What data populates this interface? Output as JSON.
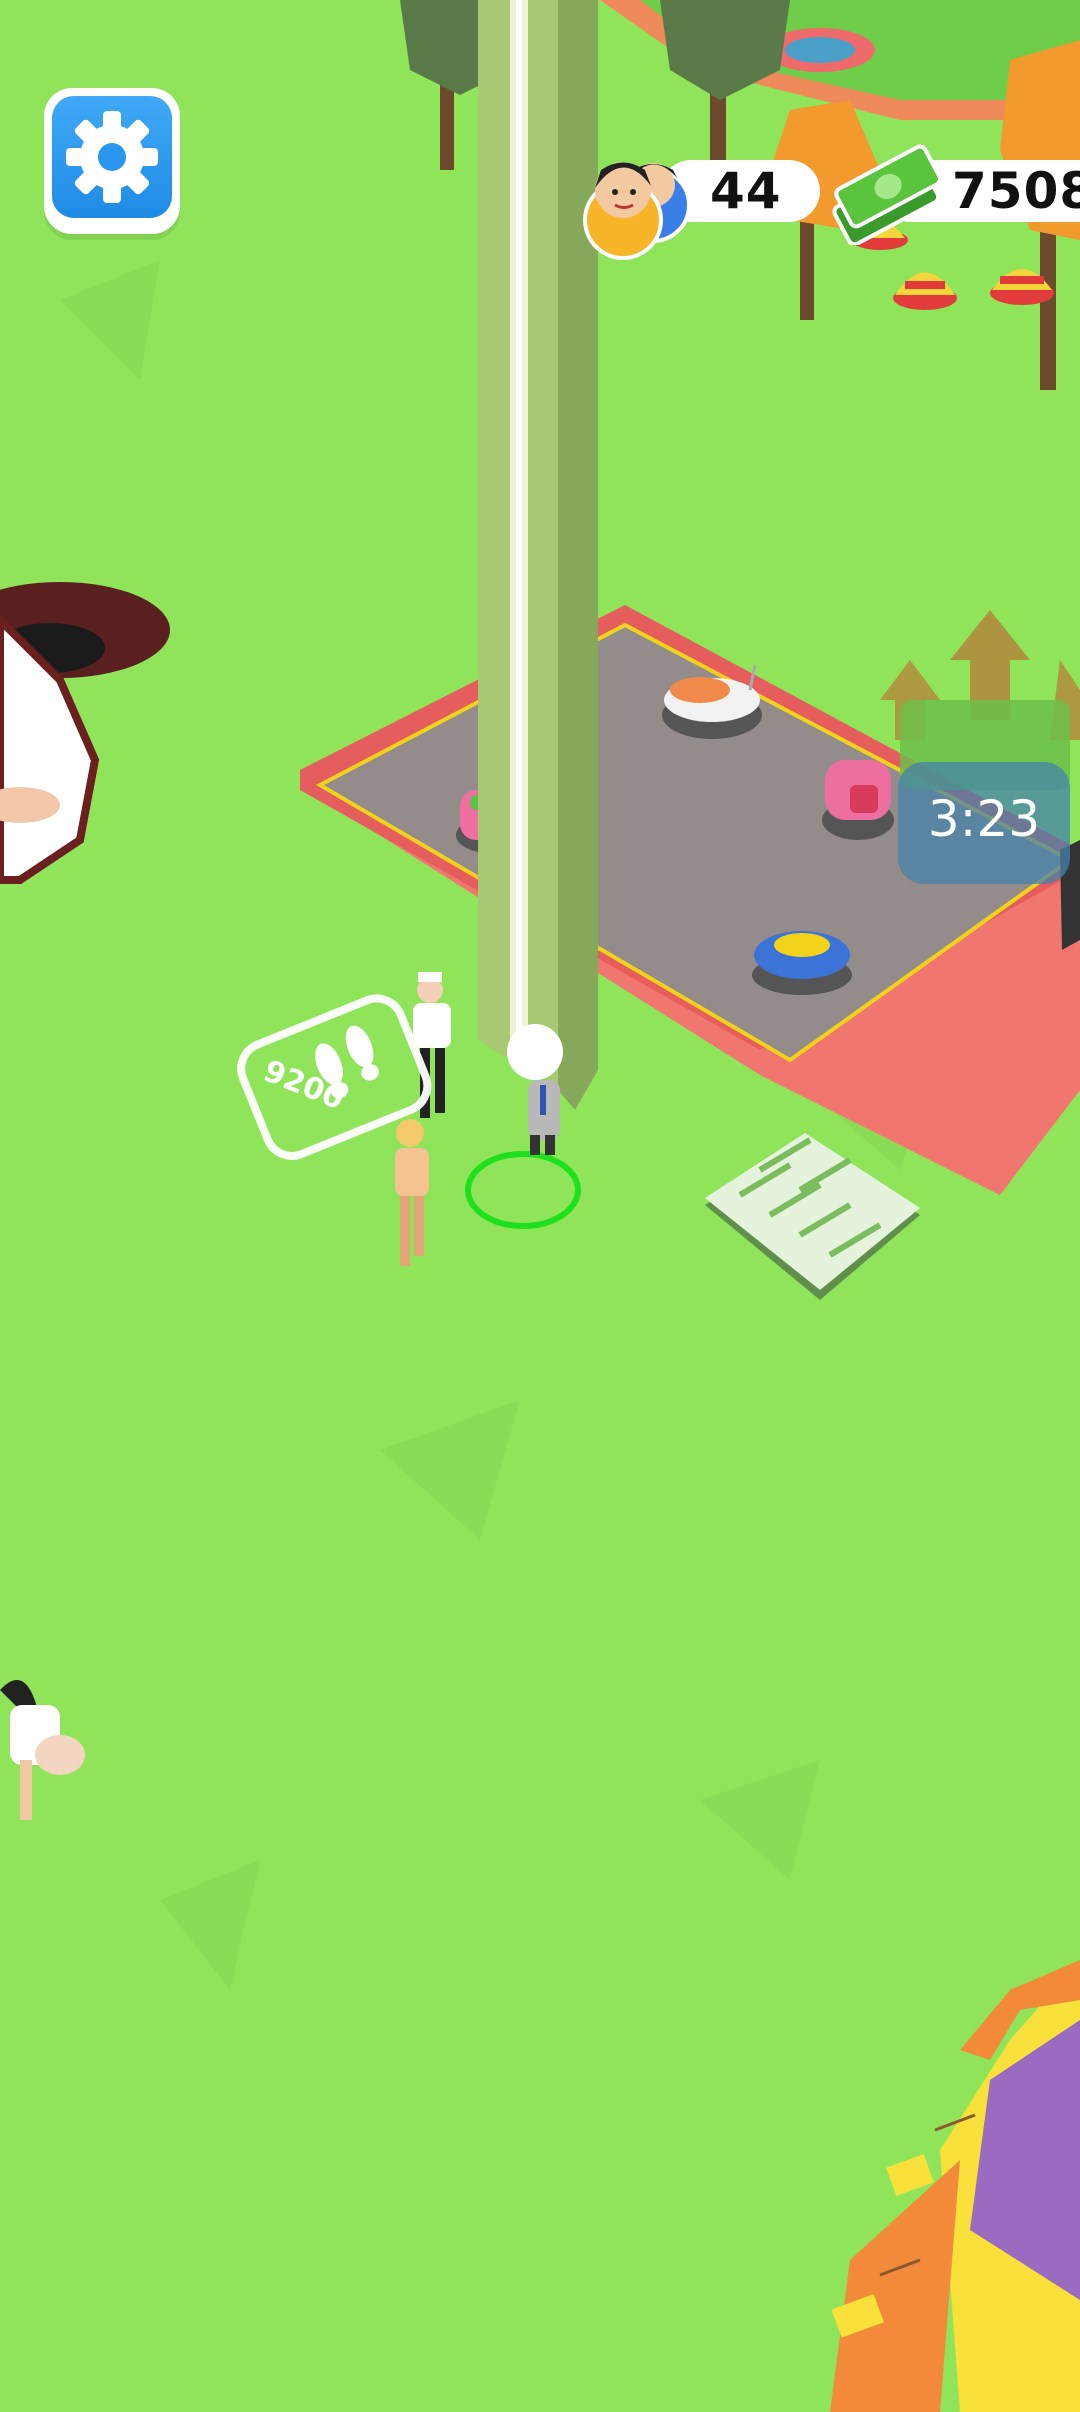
{
  "hud": {
    "settings_icon": "gear-icon",
    "visitors_icon": "visitors-faces-icon",
    "visitors_count": "44",
    "money_icon": "cash-stack-icon",
    "money_amount": "7508"
  },
  "world": {
    "timer": "3:23",
    "floor_unlock_cost": "9200",
    "footprints_icon": "footprints-icon"
  },
  "colors": {
    "grass": "#8fe45a",
    "settings_blue": "#2a96ee",
    "pad_red": "#f1766f",
    "ring_green": "#1ee01e"
  }
}
